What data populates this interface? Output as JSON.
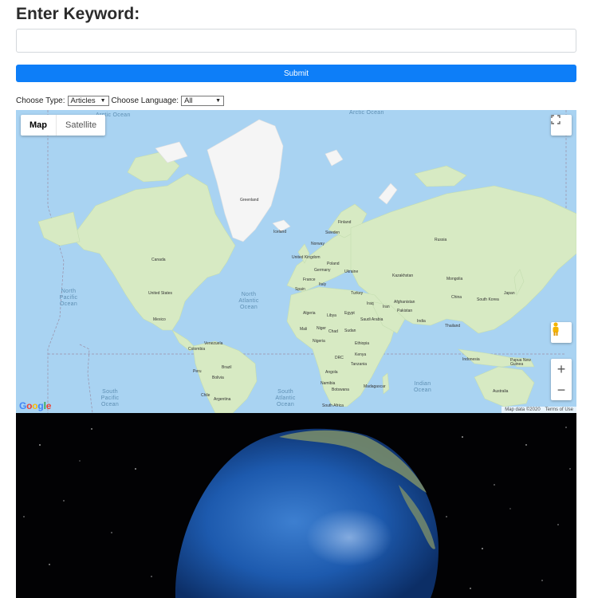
{
  "search": {
    "heading": "Enter Keyword:",
    "keyword_value": "",
    "keyword_placeholder": "",
    "submit_label": "Submit"
  },
  "filters": {
    "type_label": "Choose Type:",
    "type_selected": "Articles",
    "language_label": "Choose Language:",
    "language_selected": "All"
  },
  "map": {
    "tabs": [
      {
        "label": "Map",
        "active": true
      },
      {
        "label": "Satellite",
        "active": false
      }
    ],
    "zoom_in": "+",
    "zoom_out": "−",
    "logo": "Google",
    "attribution": "Map data ©2020",
    "terms": "Terms of Use",
    "oceans": {
      "arctic_left": "Arctic Ocean",
      "arctic_right": "Arctic Ocean",
      "north_pacific": "North\nPacific\nOcean",
      "north_atlantic": "North\nAtlantic\nOcean",
      "south_pacific": "South\nPacific\nOcean",
      "south_atlantic": "South\nAtlantic\nOcean",
      "indian": "Indian\nOcean"
    },
    "countries": {
      "greenland": "Greenland",
      "iceland": "Iceland",
      "canada": "Canada",
      "united_states": "United States",
      "mexico": "Mexico",
      "venezuela": "Venezuela",
      "colombia": "Colombia",
      "peru": "Peru",
      "brazil": "Brazil",
      "bolivia": "Bolivia",
      "chile": "Chile",
      "argentina": "Argentina",
      "finland": "Finland",
      "sweden": "Sweden",
      "norway": "Norway",
      "united_kingdom": "United Kingdom",
      "poland": "Poland",
      "germany": "Germany",
      "ukraine": "Ukraine",
      "france": "France",
      "spain": "Spain",
      "italy": "Italy",
      "turkey": "Turkey",
      "russia": "Russia",
      "kazakhstan": "Kazakhstan",
      "mongolia": "Mongolia",
      "china": "China",
      "south_korea": "South Korea",
      "japan": "Japan",
      "iraq": "Iraq",
      "iran": "Iran",
      "afghanistan": "Afghanistan",
      "pakistan": "Pakistan",
      "india": "India",
      "thailand": "Thailand",
      "algeria": "Algeria",
      "libya": "Libya",
      "egypt": "Egypt",
      "saudi_arabia": "Saudi Arabia",
      "mali": "Mali",
      "niger": "Niger",
      "chad": "Chad",
      "sudan": "Sudan",
      "nigeria": "Nigeria",
      "ethiopia": "Ethiopia",
      "drc": "DRC",
      "kenya": "Kenya",
      "tanzania": "Tanzania",
      "angola": "Angola",
      "namibia": "Namibia",
      "botswana": "Botswana",
      "madagascar": "Madagascar",
      "south_africa": "South Africa",
      "indonesia": "Indonesia",
      "papua_new_guinea": "Papua New\nGuinea",
      "australia": "Australia"
    }
  },
  "colors": {
    "accent": "#0d7ef8",
    "water": "#a9d3f2",
    "land": "#d7eac3",
    "ice": "#f5f5f5",
    "space": "#020204"
  }
}
